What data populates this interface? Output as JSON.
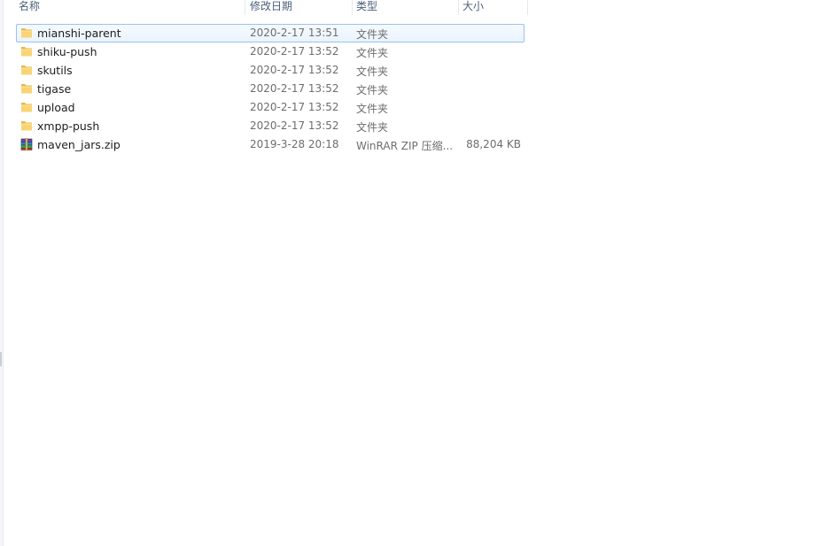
{
  "columns": {
    "name": "名称",
    "date": "修改日期",
    "type": "类型",
    "size": "大小"
  },
  "files": [
    {
      "name": "mianshi-parent",
      "date": "2020-2-17 13:51",
      "type": "文件夹",
      "size": "",
      "icon": "folder-icon"
    },
    {
      "name": "shiku-push",
      "date": "2020-2-17 13:52",
      "type": "文件夹",
      "size": "",
      "icon": "folder-icon"
    },
    {
      "name": "skutils",
      "date": "2020-2-17 13:52",
      "type": "文件夹",
      "size": "",
      "icon": "folder-icon"
    },
    {
      "name": "tigase",
      "date": "2020-2-17 13:52",
      "type": "文件夹",
      "size": "",
      "icon": "folder-icon"
    },
    {
      "name": "upload",
      "date": "2020-2-17 13:52",
      "type": "文件夹",
      "size": "",
      "icon": "folder-icon"
    },
    {
      "name": "xmpp-push",
      "date": "2020-2-17 13:52",
      "type": "文件夹",
      "size": "",
      "icon": "folder-icon"
    },
    {
      "name": "maven_jars.zip",
      "date": "2019-3-28 20:18",
      "type": "WinRAR ZIP 压缩...",
      "size": "88,204 KB",
      "icon": "winrar-archive-icon"
    }
  ],
  "colors": {
    "selection_border": "#99c3f0",
    "selection_fill": "#eaf3fd",
    "header_text": "#4c607a",
    "detail_text": "#6d6d6d"
  }
}
